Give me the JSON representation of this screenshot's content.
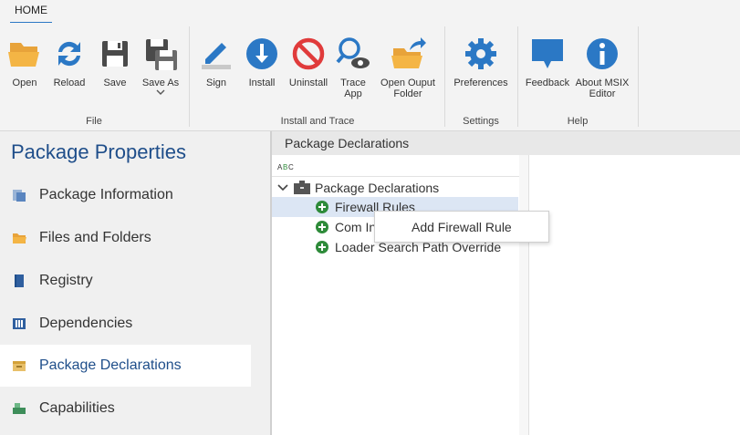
{
  "ribbon": {
    "tab": "HOME",
    "buttons": {
      "open": "Open",
      "reload": "Reload",
      "save": "Save",
      "save_as": "Save As",
      "sign": "Sign",
      "install": "Install",
      "uninstall": "Uninstall",
      "trace_app": "Trace\nApp",
      "open_output": "Open Ouput\nFolder",
      "preferences": "Preferences",
      "feedback": "Feedback",
      "about": "About MSIX\nEditor"
    },
    "groups": {
      "file": "File",
      "install_trace": "Install and Trace",
      "settings": "Settings",
      "help": "Help"
    }
  },
  "sidebar": {
    "title": "Package Properties",
    "items": [
      {
        "label": "Package Information",
        "icon": "package-info-icon"
      },
      {
        "label": "Files and Folders",
        "icon": "folder-icon"
      },
      {
        "label": "Registry",
        "icon": "registry-icon"
      },
      {
        "label": "Dependencies",
        "icon": "dependencies-icon"
      },
      {
        "label": "Package Declarations",
        "icon": "declarations-icon",
        "selected": true
      },
      {
        "label": "Capabilities",
        "icon": "capabilities-icon"
      }
    ]
  },
  "main": {
    "header": "Package Declarations",
    "tree": {
      "root": "Package Declarations",
      "children": [
        "Firewall Rules",
        "Com In",
        "Loader Search Path Override"
      ]
    },
    "context_menu": {
      "item": "Add Firewall Rule"
    }
  },
  "colors": {
    "accent": "#2b78c5",
    "sidebar_title": "#1f4e8a",
    "add_green": "#2e8b3a",
    "selection": "#dce6f4"
  }
}
